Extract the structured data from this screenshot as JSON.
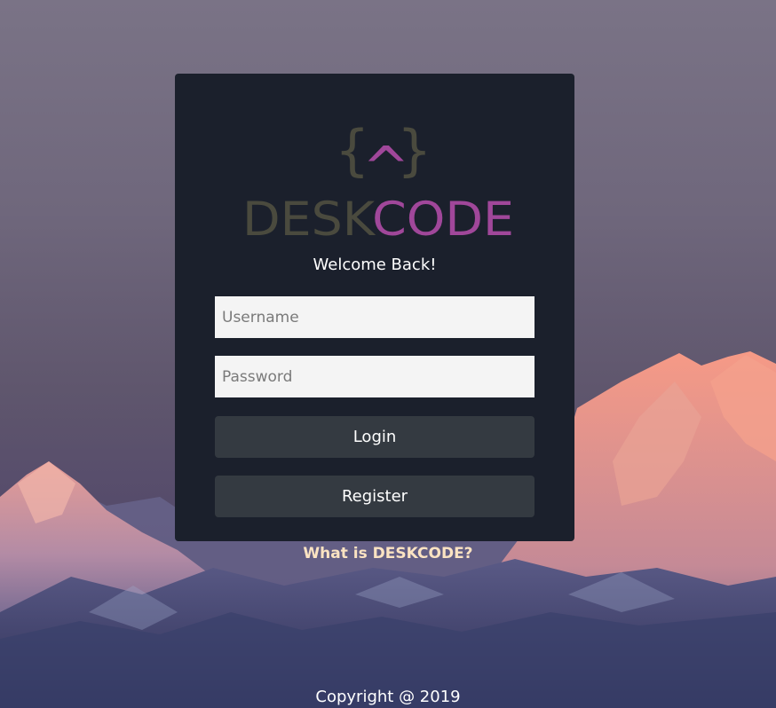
{
  "logo": {
    "brace_left": "{",
    "brace_right": "}",
    "caret": "^",
    "word_part1": "DESK",
    "word_part2": "CODE",
    "color_part1": "#4a4a3e",
    "color_part2": "#a0479a"
  },
  "login_card": {
    "welcome_text": "Welcome Back!",
    "username_placeholder": "Username",
    "password_placeholder": "Password",
    "login_label": "Login",
    "register_label": "Register"
  },
  "links": {
    "what_is": "What is DESKCODE?"
  },
  "footer": {
    "copyright": "Copyright @ 2019"
  },
  "colors": {
    "card_bg": "#1b202c",
    "button_bg": "#343a41",
    "input_bg": "#f4f4f4",
    "link_color": "#fbe3c2"
  }
}
